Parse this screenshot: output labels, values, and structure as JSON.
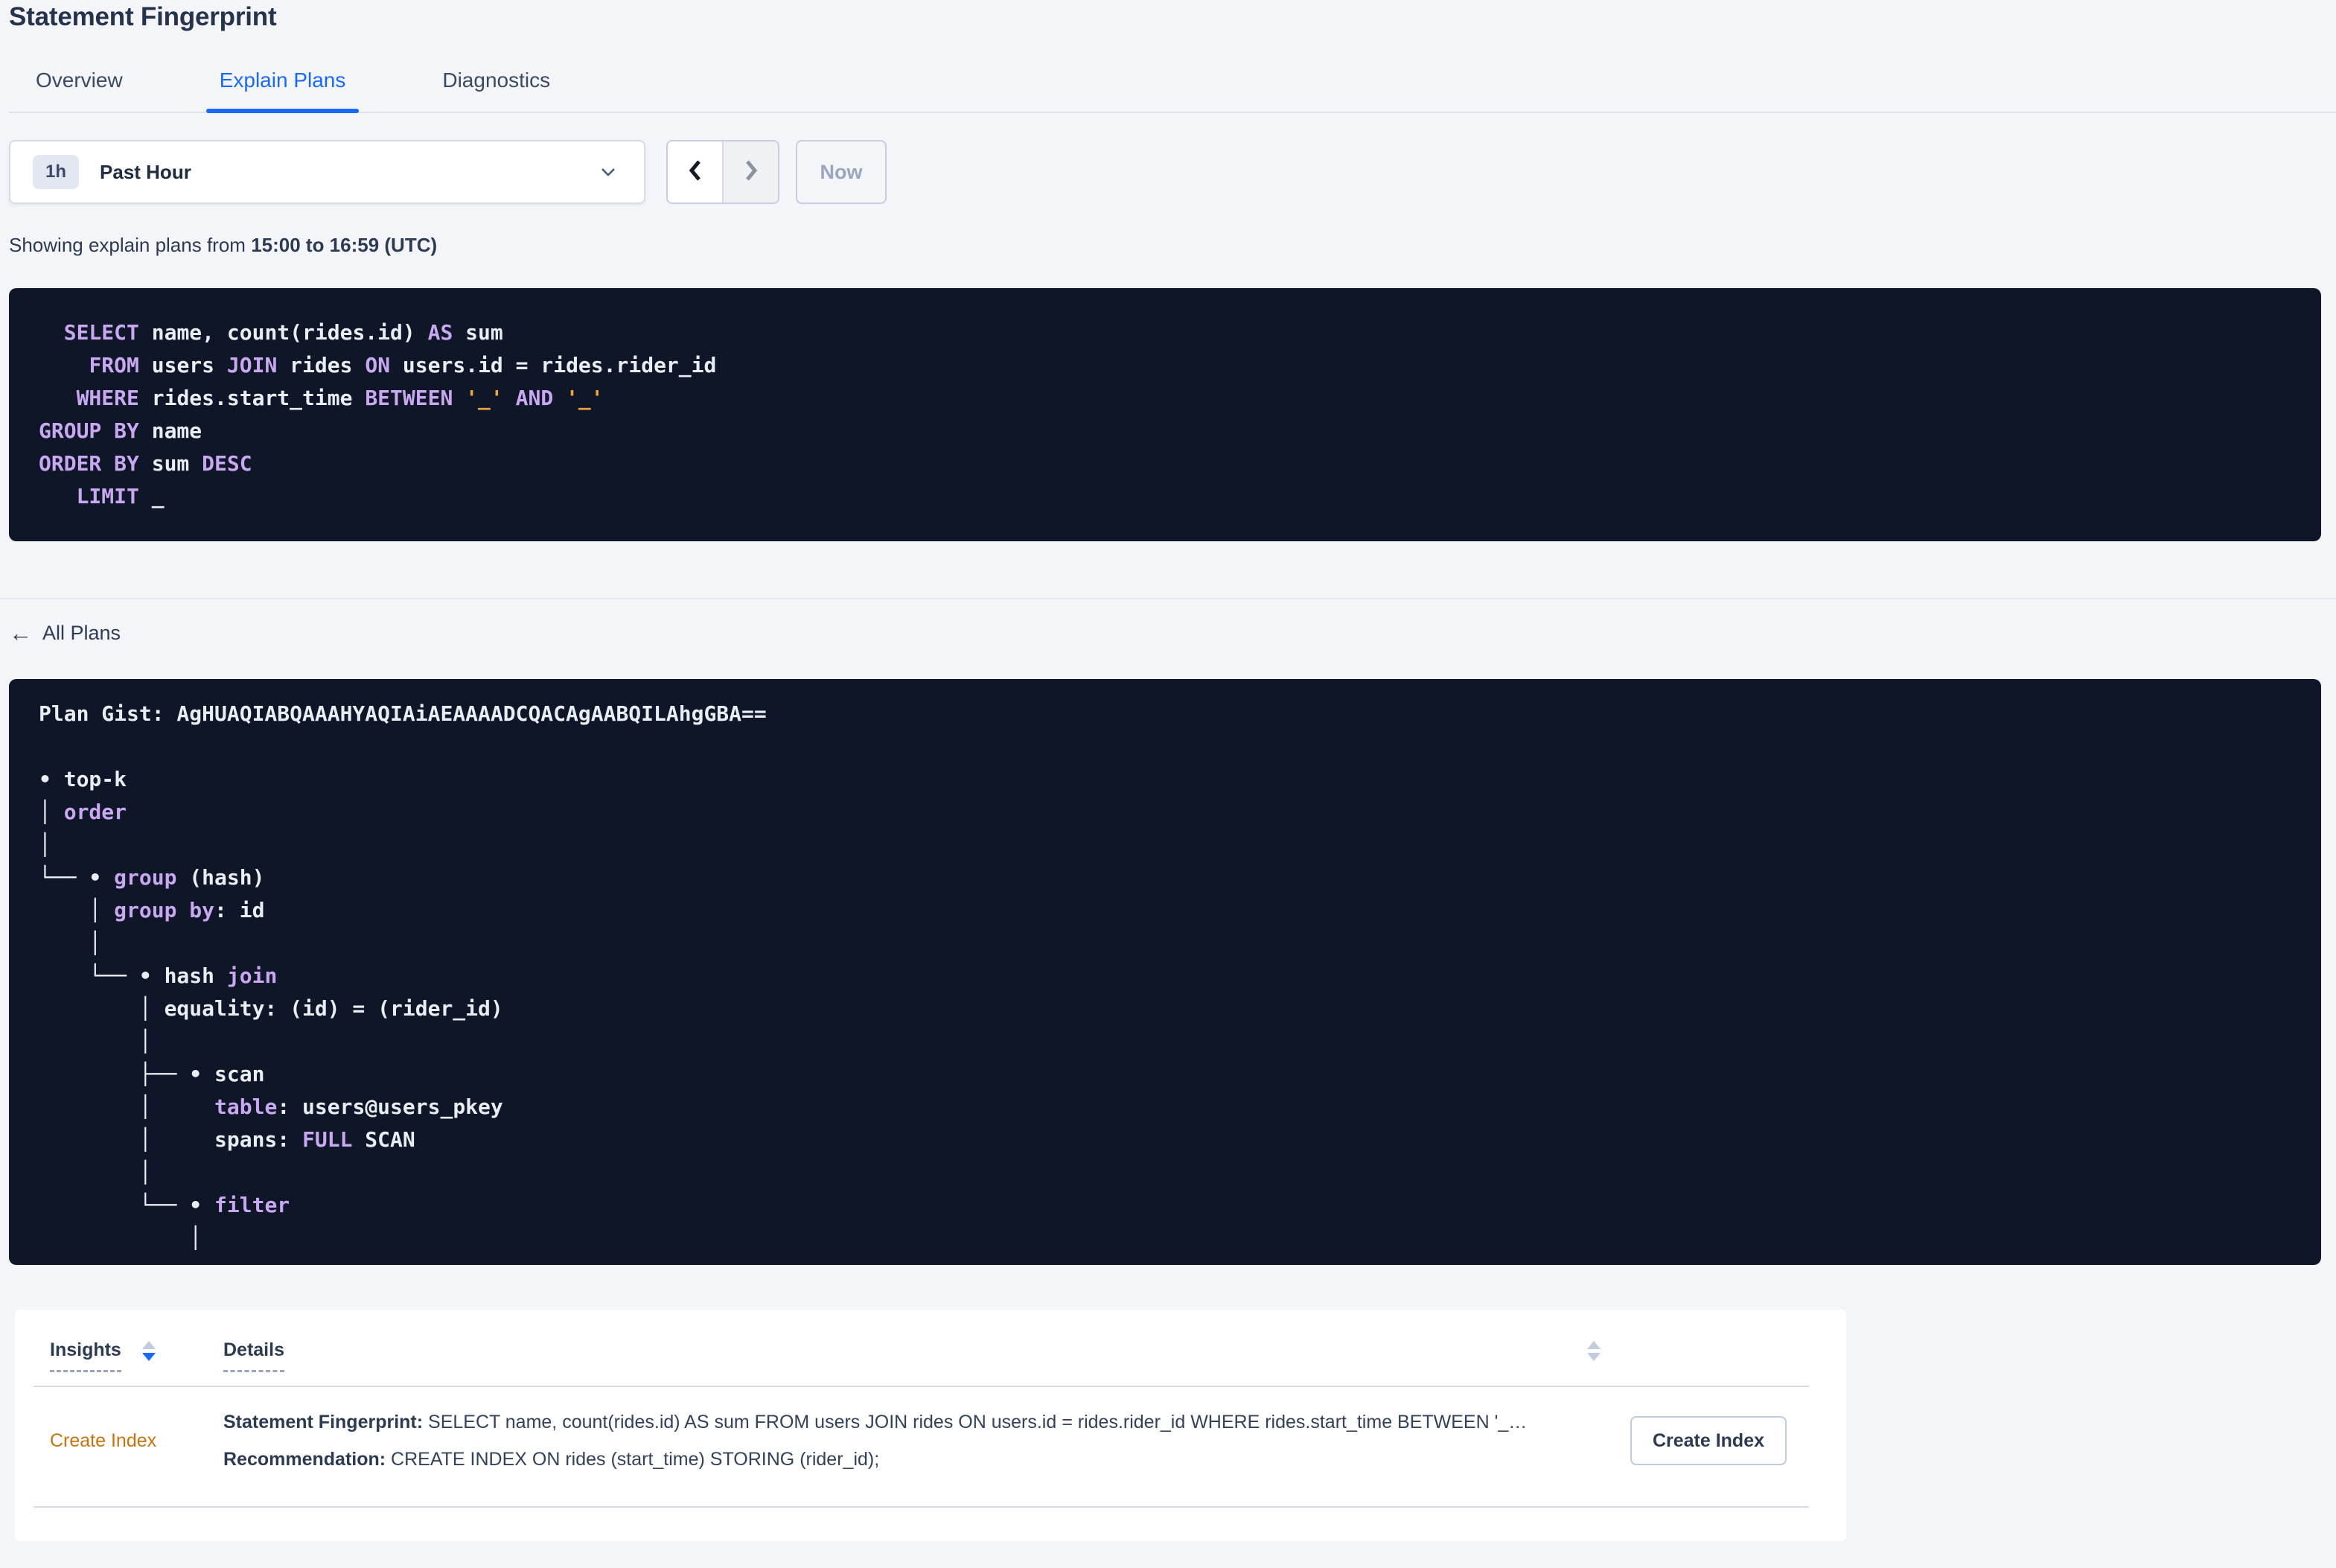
{
  "page_title": "Statement Fingerprint",
  "tabs": [
    {
      "label": "Overview"
    },
    {
      "label": "Explain Plans"
    },
    {
      "label": "Diagnostics"
    }
  ],
  "time_picker": {
    "badge": "1h",
    "label": "Past Hour",
    "now_label": "Now"
  },
  "showing": {
    "prefix": "Showing explain plans from ",
    "range": "15:00 to 16:59 (UTC)"
  },
  "sql_block": {
    "lines": [
      [
        {
          "t": "  "
        },
        {
          "t": "SELECT",
          "c": "kw"
        },
        {
          "t": " name, count(rides.id) "
        },
        {
          "t": "AS",
          "c": "kw"
        },
        {
          "t": " sum"
        }
      ],
      [
        {
          "t": "    "
        },
        {
          "t": "FROM",
          "c": "kw"
        },
        {
          "t": " users "
        },
        {
          "t": "JOIN",
          "c": "kw"
        },
        {
          "t": " rides "
        },
        {
          "t": "ON",
          "c": "kw"
        },
        {
          "t": " users.id = rides.rider_id"
        }
      ],
      [
        {
          "t": "   "
        },
        {
          "t": "WHERE",
          "c": "kw"
        },
        {
          "t": " rides.start_time "
        },
        {
          "t": "BETWEEN",
          "c": "kw"
        },
        {
          "t": " "
        },
        {
          "t": "'_'",
          "c": "lit"
        },
        {
          "t": " "
        },
        {
          "t": "AND",
          "c": "kw"
        },
        {
          "t": " "
        },
        {
          "t": "'_'",
          "c": "lit"
        }
      ],
      [
        {
          "t": "GROUP BY",
          "c": "kw"
        },
        {
          "t": " name"
        }
      ],
      [
        {
          "t": "ORDER BY",
          "c": "kw"
        },
        {
          "t": " sum "
        },
        {
          "t": "DESC",
          "c": "kw"
        }
      ],
      [
        {
          "t": "   "
        },
        {
          "t": "LIMIT",
          "c": "kw"
        },
        {
          "t": " _"
        }
      ]
    ]
  },
  "plan_section": {
    "back_label": "All Plans"
  },
  "plan_block": {
    "lines": [
      [
        {
          "t": "Plan Gist: AgHUAQIABQAAAHYAQIAiAEAAAADCQACAgAABQILAhgGBA=="
        }
      ],
      [],
      [
        {
          "t": "• top-k"
        }
      ],
      [
        {
          "t": "│ "
        },
        {
          "t": "order",
          "c": "kw"
        }
      ],
      [
        {
          "t": "│"
        }
      ],
      [
        {
          "t": "└── • "
        },
        {
          "t": "group",
          "c": "kw"
        },
        {
          "t": " (hash)"
        }
      ],
      [
        {
          "t": "    │ "
        },
        {
          "t": "group by",
          "c": "kw"
        },
        {
          "t": ": id"
        }
      ],
      [
        {
          "t": "    │"
        }
      ],
      [
        {
          "t": "    └── • hash "
        },
        {
          "t": "join",
          "c": "kw"
        }
      ],
      [
        {
          "t": "        │ equality: (id) = (rider_id)"
        }
      ],
      [
        {
          "t": "        │"
        }
      ],
      [
        {
          "t": "        ├── • scan"
        }
      ],
      [
        {
          "t": "        │     "
        },
        {
          "t": "table",
          "c": "kw"
        },
        {
          "t": ": users@users_pkey"
        }
      ],
      [
        {
          "t": "        │     spans: "
        },
        {
          "t": "FULL",
          "c": "kw"
        },
        {
          "t": " SCAN"
        }
      ],
      [
        {
          "t": "        │"
        }
      ],
      [
        {
          "t": "        └── • "
        },
        {
          "t": "filter",
          "c": "kw"
        }
      ],
      [
        {
          "t": "            │"
        }
      ]
    ]
  },
  "insights_table": {
    "columns": [
      {
        "label": "Insights"
      },
      {
        "label": "Details"
      }
    ],
    "rows": [
      {
        "insight": "Create Index",
        "fingerprint_label": "Statement Fingerprint:",
        "fingerprint": " SELECT name, count(rides.id) AS sum FROM users JOIN rides ON users.id = rides.rider_id WHERE rides.start_time BETWEEN '_…",
        "recommendation_label": "Recommendation:",
        "recommendation": " CREATE INDEX ON rides (start_time) STORING (rider_id);",
        "action_label": "Create Index"
      }
    ]
  },
  "colors": {
    "accent_blue": "#1a6af5",
    "code_background": "#0e1628",
    "keyword_lavender": "#c9a8f2",
    "literal_orange": "#efa53d",
    "insight_orange": "#c87310"
  }
}
